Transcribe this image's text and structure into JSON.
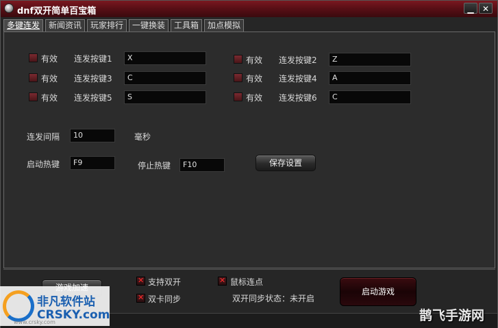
{
  "window": {
    "title": "dnf双开简单百宝箱",
    "min_glyph": "▁",
    "close_glyph": "✕"
  },
  "tabs": [
    {
      "label": "多键连发",
      "active": true
    },
    {
      "label": "新闻资讯"
    },
    {
      "label": "玩家排行"
    },
    {
      "label": "一键换装"
    },
    {
      "label": "工具箱"
    },
    {
      "label": "加点模拟"
    }
  ],
  "keys": [
    {
      "enable": "有效",
      "label": "连发按键1",
      "value": "X"
    },
    {
      "enable": "有效",
      "label": "连发按键3",
      "value": "C"
    },
    {
      "enable": "有效",
      "label": "连发按键5",
      "value": "S"
    },
    {
      "enable": "有效",
      "label": "连发按键2",
      "value": "Z"
    },
    {
      "enable": "有效",
      "label": "连发按键4",
      "value": "A"
    },
    {
      "enable": "有效",
      "label": "连发按键6",
      "value": "C"
    }
  ],
  "interval": {
    "label": "连发间隔",
    "value": "10",
    "unit": "毫秒"
  },
  "hotkeys": {
    "start_label": "启动热键",
    "start_value": "F9",
    "stop_label": "停止热键",
    "stop_value": "F10",
    "save_label": "保存设置"
  },
  "bottom": {
    "accelerate_label": "游戏加速",
    "dual_open_label": "支持双开",
    "dual_card_label": "双卡同步",
    "mouse_click_label": "鼠标连点",
    "status_text": "双开同步状态：未开启",
    "start_game_label": "启动游戏"
  },
  "watermark": {
    "left_cn": "非凡软件站",
    "left_en": "CRSKY.com",
    "left_url": "www.crsky.com",
    "right_text": "鹊飞手游网"
  },
  "colors": {
    "titlebar": "#5a0f16",
    "check_mark": "#ff2a2a",
    "brand_blue": "#1a5fb0"
  }
}
